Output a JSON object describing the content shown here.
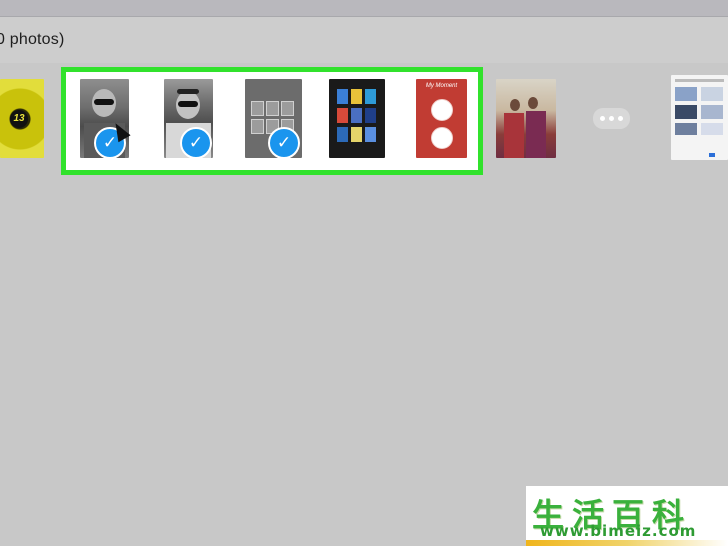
{
  "header": {
    "title": "0 photos)"
  },
  "photos": [
    {
      "name": "flower-photo",
      "label": "13",
      "selected": false
    },
    {
      "name": "portrait-photo-1",
      "selected": true
    },
    {
      "name": "portrait-photo-2",
      "selected": true
    },
    {
      "name": "app-screenshot-photo",
      "selected": true
    },
    {
      "name": "book-grid-photo",
      "selected": false
    },
    {
      "name": "mymoment-app-photo",
      "app_title": "My Moment",
      "selected": false
    },
    {
      "name": "couple-photo",
      "selected": false
    },
    {
      "name": "web-screenshot-photo",
      "selected": false
    }
  ],
  "selection": {
    "highlight_color": "#31e22c",
    "check_color": "#1a95ee",
    "check_glyph": "✓"
  },
  "more_button": {
    "icon": "ellipsis-icon"
  },
  "watermark": {
    "chinese": "生活百科",
    "url": "www.bimeiz.com"
  }
}
